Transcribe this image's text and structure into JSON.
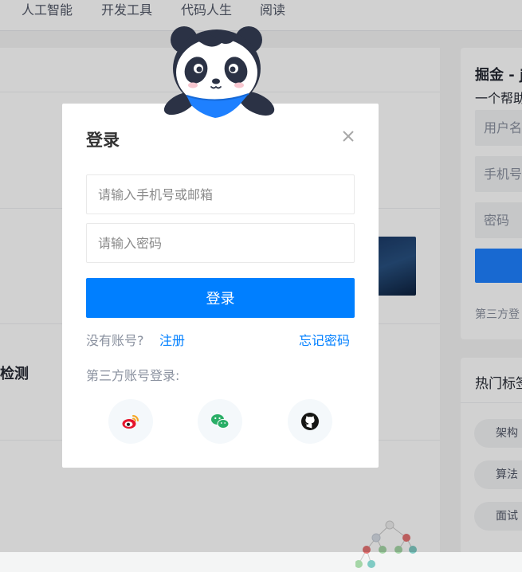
{
  "topnav": {
    "items": [
      "人工智能",
      "开发工具",
      "代码人生",
      "阅读"
    ]
  },
  "feed": {
    "partial_title": "检测"
  },
  "sidebar": {
    "title": "掘金 - j",
    "subtitle": "一个帮助",
    "username_placeholder": "用户名",
    "phone_placeholder": "手机号",
    "password_placeholder": "密码",
    "third_party": "第三方登"
  },
  "tags": {
    "title": "热门标签",
    "items": [
      "架构",
      "算法",
      "面试"
    ]
  },
  "login": {
    "title": "登录",
    "account_placeholder": "请输入手机号或邮箱",
    "account_value": "",
    "password_placeholder": "请输入密码",
    "password_value": "",
    "submit_label": "登录",
    "no_account": "没有账号?",
    "register": "注册",
    "forgot": "忘记密码",
    "third_party_label": "第三方账号登录:",
    "providers": [
      "weibo-icon",
      "wechat-icon",
      "github-icon"
    ]
  },
  "colors": {
    "primary": "#007fff",
    "overlay": "rgba(0,0,0,0.18)",
    "weibo": "#e6162d",
    "wechat": "#2aae67",
    "github": "#161614"
  }
}
